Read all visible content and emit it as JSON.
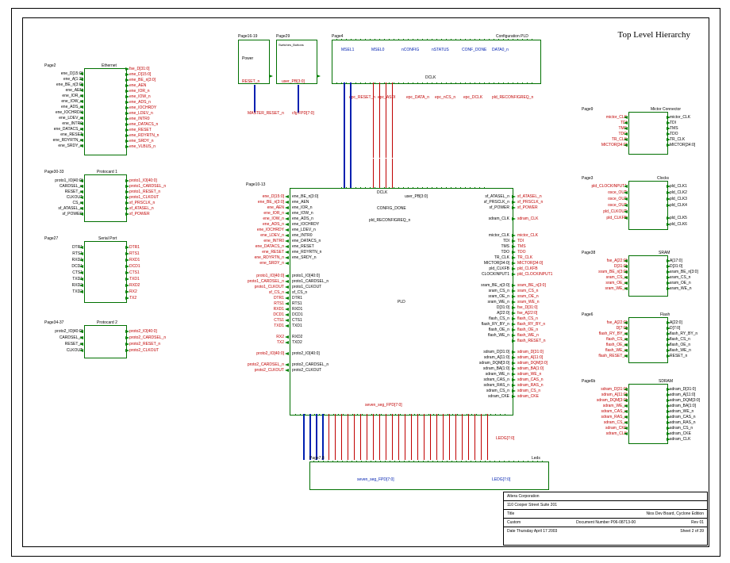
{
  "page_title": "Top Level Hierarchy",
  "blocks": {
    "ethernet": {
      "page": "Page2",
      "name": "Ethernet"
    },
    "protocard1": {
      "page": "Page30-33",
      "name": "Protocard 1"
    },
    "serial": {
      "page": "Page27",
      "name": "Serial Port"
    },
    "protocard2": {
      "page": "Page34-37",
      "name": "Protocard 2"
    },
    "power": {
      "page": "Page16-19",
      "name": "Power"
    },
    "switches": {
      "page": "Page29",
      "name": "Switches_Buttons"
    },
    "config_pld": {
      "page": "Page4",
      "name": "Configuration PLD"
    },
    "pld": {
      "page": "Page10-13",
      "name": "PLD"
    },
    "leds": {
      "page": "Page7,8",
      "name": "Leds"
    },
    "mictor": {
      "page": "Page9",
      "name": "Mictor Connector"
    },
    "clocks": {
      "page": "Page3",
      "name": "Clocks"
    },
    "sram": {
      "page": "Page38",
      "name": "SRAM"
    },
    "flash": {
      "page": "Page6",
      "name": "Flash"
    },
    "sdram": {
      "page": "Page6b",
      "name": "SDRAM"
    }
  },
  "nets": {
    "eth_left": [
      "ene_D[15:0]",
      "ene_A[1:3]",
      "ene_BE_n[3:0]",
      "ene_AEN",
      "ene_IOR_n",
      "ene_IOW_n",
      "ene_ADS_n",
      "ene_IOCHRDY",
      "ene_LDEV_n",
      "ene_INTR0",
      "ene_DATACS_n",
      "ene_RESET",
      "ene_RDYRTN_n",
      "ene_SRDY_n"
    ],
    "eth_right": [
      "fse_D[31:0]",
      "ene_D[15:0]",
      "ene_BE_n[3:0]",
      "ene_AEN",
      "ene_IOR_n",
      "ene_IOW_n",
      "ene_ADS_n",
      "ene_IOCHRDY",
      "ene_LDEV_n",
      "ene_INTR0",
      "ene_DATACS_n",
      "ene_RESET",
      "ene_RDYRTN_n",
      "ene_SRDY_n",
      "ene_VLBUS_n"
    ],
    "proto1_left": [
      "proto1_IO[40:0]",
      "CARDSEL_n",
      "RESET_n",
      "CLKOUT",
      "CS_n",
      "sf_ATASEL_n",
      "sf_POWER"
    ],
    "proto1_right": [
      "proto1_IO[40:0]",
      "proto1_CARDSEL_n",
      "proto1_RESET_n",
      "proto1_CLKOUT",
      "sf_PRSCLK_n",
      "sf_ATASEL_n",
      "sf_POWER"
    ],
    "serial_left": [
      "DTR1",
      "RTS1",
      "RXD1",
      "DCD1",
      "CTS1",
      "TXD1",
      "RXD2",
      "TXD2"
    ],
    "serial_right": [
      "DTR1",
      "RTS1",
      "RXD1",
      "DCD1",
      "CTS1",
      "TXD1",
      "RXD2",
      "RX2",
      "TX2"
    ],
    "proto2_left": [
      "proto2_IO[40:0]",
      "CARDSEL_n",
      "RESET_n",
      "CLKOUT"
    ],
    "proto2_right": [
      "proto2_IO[40:0]",
      "proto2_CARDSEL_n",
      "proto2_RESET_n",
      "proto2_CLKOUT"
    ],
    "power_right": [
      "RESET_n"
    ],
    "switches_right": [
      "user_PB[3:0]"
    ],
    "mictor_left": [
      "mictor_CLK",
      "TDI",
      "TMS",
      "TDO",
      "TR_CLK",
      "MICTOR[34:0]"
    ],
    "mictor_right": [
      "mictor_CLK",
      "TDI",
      "TMS",
      "TDO",
      "TR_CLK",
      "MICTOR[34:0]"
    ],
    "clocks_left": [
      "pld_CLOCKINPUT1",
      "osce_OUT",
      "osce_OUT",
      "osce_OUT",
      "pld_CLKOUT",
      "pld_CLKFB"
    ],
    "clocks_right": [
      "pld_CLK1",
      "pld_CLK2",
      "pld_CLK3",
      "pld_CLK4",
      "",
      "pld_CLK5",
      "pld_CLK6"
    ],
    "sram_left": [
      "fse_A[22:0]",
      "D[31:0]",
      "sram_BE_n[3:0]",
      "sram_CS_n",
      "sram_OE_n",
      "sram_WE_n"
    ],
    "sram_right": [
      "A[17:0]",
      "D[31:0]",
      "sram_BE_n[3:0]",
      "sram_CS_n",
      "sram_OE_n",
      "sram_WE_n"
    ],
    "flash_left": [
      "fse_A[22:0]",
      "D[7:0]",
      "flash_RY_BY_n",
      "flash_CS_n",
      "flash_OE_n",
      "flash_WE_n",
      "flash_RESET_n"
    ],
    "flash_right": [
      "A[22:0]",
      "D[7:0]",
      "flash_RY_BY_n",
      "flash_CS_n",
      "flash_OE_n",
      "flash_WE_n",
      "RESET_n"
    ],
    "sdram_left": [
      "sdram_D[31:0]",
      "sdram_A[11:0]",
      "sdram_DQM[3:0]",
      "sdram_WE_n",
      "sdram_CAS_n",
      "sdram_RAS_n",
      "sdram_CS_n",
      "sdram_CKE",
      "sdram_CLK"
    ],
    "sdram_right": [
      "sdram_D[31:0]",
      "sdram_A[11:0]",
      "sdram_DQM[3:0]",
      "sdram_BA[1:0]",
      "sdram_WE_n",
      "sdram_CAS_n",
      "sdram_RAS_n",
      "sdram_CS_n",
      "sdram_CKE",
      "sdram_CLK"
    ],
    "pld_left_ports": [
      "ene_BE_n[3:0]",
      "ene_AEN",
      "ene_IOR_n",
      "ene_IOW_n",
      "ene_ADS_n",
      "ene_IOCHRDY",
      "ene_LDEV_n",
      "ene_INTR0",
      "ene_DATACS_n",
      "ene_RESET",
      "ene_RDYRTN_n",
      "ene_SRDY_n"
    ],
    "pld_left_nets": [
      "ene_D[15:0]",
      "ene_BE_n[3:0]",
      "ene_AEN",
      "ene_IOR_n",
      "ene_IOW_n",
      "ene_ADS_n",
      "ene_IOCHRDY",
      "ene_LDEV_n",
      "ene_INTR0",
      "ene_DATACS_n",
      "ene_RESET",
      "ene_RDYRTN_n",
      "ene_SRDY_n"
    ],
    "pld_left2_ports": [
      "proto1_IO[40:0]",
      "proto1_CARDSEL_n",
      "proto1_CLKOUT",
      "sf_CS_n",
      "DTR1",
      "RTS1",
      "RXD1",
      "DCD1",
      "CTS1",
      "TXD1",
      "",
      "RXD2",
      "TXD2",
      "",
      "proto2_IO[40:0]",
      "",
      "proto2_CARDSEL_n",
      "proto2_CLKOUT"
    ],
    "pld_left2_nets": [
      "proto1_IO[40:0]",
      "proto1_CARDSEL_n",
      "proto1_CLKOUT",
      "sf_CS_n",
      "DTR1",
      "RTS1",
      "RXD1",
      "DCD1",
      "CTS1",
      "TXD1",
      "",
      "RX2",
      "TX2",
      "",
      "proto2_IO[40:0]",
      "",
      "proto2_CARDSEL_n",
      "proto2_CLKOUT"
    ],
    "pld_right_nets": [
      "sf_ATASEL_n",
      "sf_PRSCLK_n",
      "sf_POWER",
      "",
      "sdram_CLK",
      "",
      "",
      "mictor_CLK",
      "TDI",
      "TMS",
      "TDO",
      "TR_CLK",
      "MICTOR[34:0]",
      "pld_CLKFB",
      "pld_CLOCKINPUT1",
      "",
      "sram_BE_n[3:0]",
      "sram_CS_n",
      "sram_OE_n",
      "sram_WE_n",
      "fse_D[31:0]",
      "fse_A[22:0]",
      "flash_CS_n",
      "flash_RY_BY_n",
      "flash_OE_n",
      "flash_WE_n",
      "flash_RESET_n",
      "",
      "sdram_D[31:0]",
      "sdram_A[11:0]",
      "sdram_DQM[3:0]",
      "sdram_BA[1:0]",
      "sdram_WE_n",
      "sdram_CAS_n",
      "sdram_RAS_n",
      "sdram_CS_n",
      "sdram_CKE"
    ],
    "pld_right_ports": [
      "sf_ATASEL_n",
      "sf_PRSCLK_n",
      "sf_POWER",
      "",
      "sdram_CLK",
      "",
      "",
      "mictor_CLK",
      "TDI",
      "TMS",
      "TDO",
      "TR_CLK",
      "MICTOR[34:0]",
      "pld_CLKFB",
      "CLOCKINPUT1",
      "",
      "sram_BE_n[3:0]",
      "sram_CS_n",
      "sram_OE_n",
      "sram_WE_n",
      "D[31:0]",
      "A[22:0]",
      "flash_CS_n",
      "flash_RY_BY_n",
      "flash_OE_n",
      "flash_WE_n",
      "",
      "",
      "sdram_D[31:0]",
      "sdram_A[11:0]",
      "sdram_DQM[3:0]",
      "sdram_BA[1:0]",
      "sdram_WE_n",
      "sdram_CAS_n",
      "sdram_RAS_n",
      "sdram_CS_n",
      "sdram_CKE"
    ],
    "pld_center": [
      "DCLK",
      "user_PB[3:0]",
      "CONFIG_DONE",
      "pld_RECONFIGREQ_n"
    ],
    "pld_name": "PLD",
    "cfg_top": [
      "MSEL1",
      "MSEL0",
      "nCONFIG",
      "nSTATUS",
      "CONF_DONE",
      "DATA0_n"
    ],
    "cfg_bot": [
      "epc_RESET_n",
      "epc_ASDI",
      "epc_DATA_n",
      "epc_nCS_n",
      "epc_DCLK",
      "pld_RECONFIGREQ_n"
    ],
    "master_reset": "MASTER_RESET_n",
    "cfg_bus": "cfg FPD[7:0]",
    "seven_seg": "seven_seg_FPD[7:0]",
    "leds": "LEDG[7:0]",
    "leds_bot": "seven_seg_FPD[7:0]"
  },
  "titleblock": {
    "company": "Altera Corporation",
    "addr": "110 Cooper Street Suite 201",
    "title": "Nios Dev Board, Cyclone Edition",
    "size": "Custom",
    "doc": "Document Number  P06-08713-00",
    "rev": "01",
    "date": "Thursday April 17 2003",
    "sheet": "Sheet 2 of 39"
  }
}
